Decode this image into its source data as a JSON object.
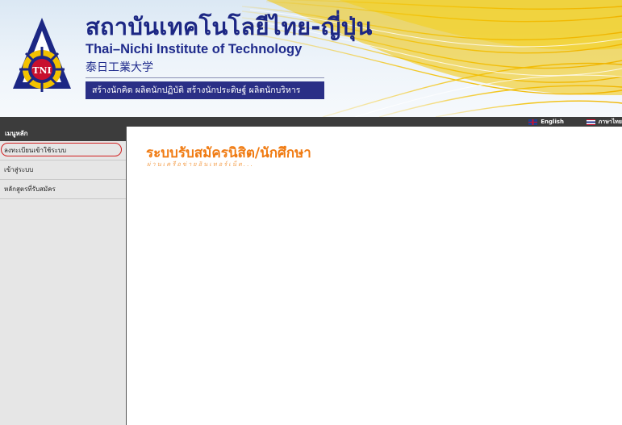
{
  "header": {
    "title_thai": "สถาบันเทคโนโลยีไทย-ญี่ปุ่น",
    "title_english": "Thai–Nichi Institute of Technology",
    "title_japanese": "泰日工業大学",
    "slogan": "สร้างนักคิด ผลิตนักปฏิบัติ สร้างนักประดิษฐ์ ผลิตนักบริหาร",
    "logo_text": "TNI",
    "colors": {
      "navy": "#1c2784",
      "gold": "#f2c200"
    }
  },
  "language_bar": {
    "english_label": "English",
    "thai_label": "ภาษาไทย"
  },
  "sidebar": {
    "title": "เมนูหลัก",
    "items": [
      {
        "label": "ลงทะเบียนเข้าใช้ระบบ",
        "highlighted": true
      },
      {
        "label": "เข้าสู่ระบบ",
        "highlighted": false
      },
      {
        "label": "หลักสูตรที่รับสมัคร",
        "highlighted": false
      }
    ]
  },
  "main": {
    "title": "ระบบรับสมัครนิสิต/นักศึกษา",
    "subtitle": "ผ่านเครือข่ายอินเทอร์เน็ต...",
    "accent_color": "#f07b12"
  }
}
